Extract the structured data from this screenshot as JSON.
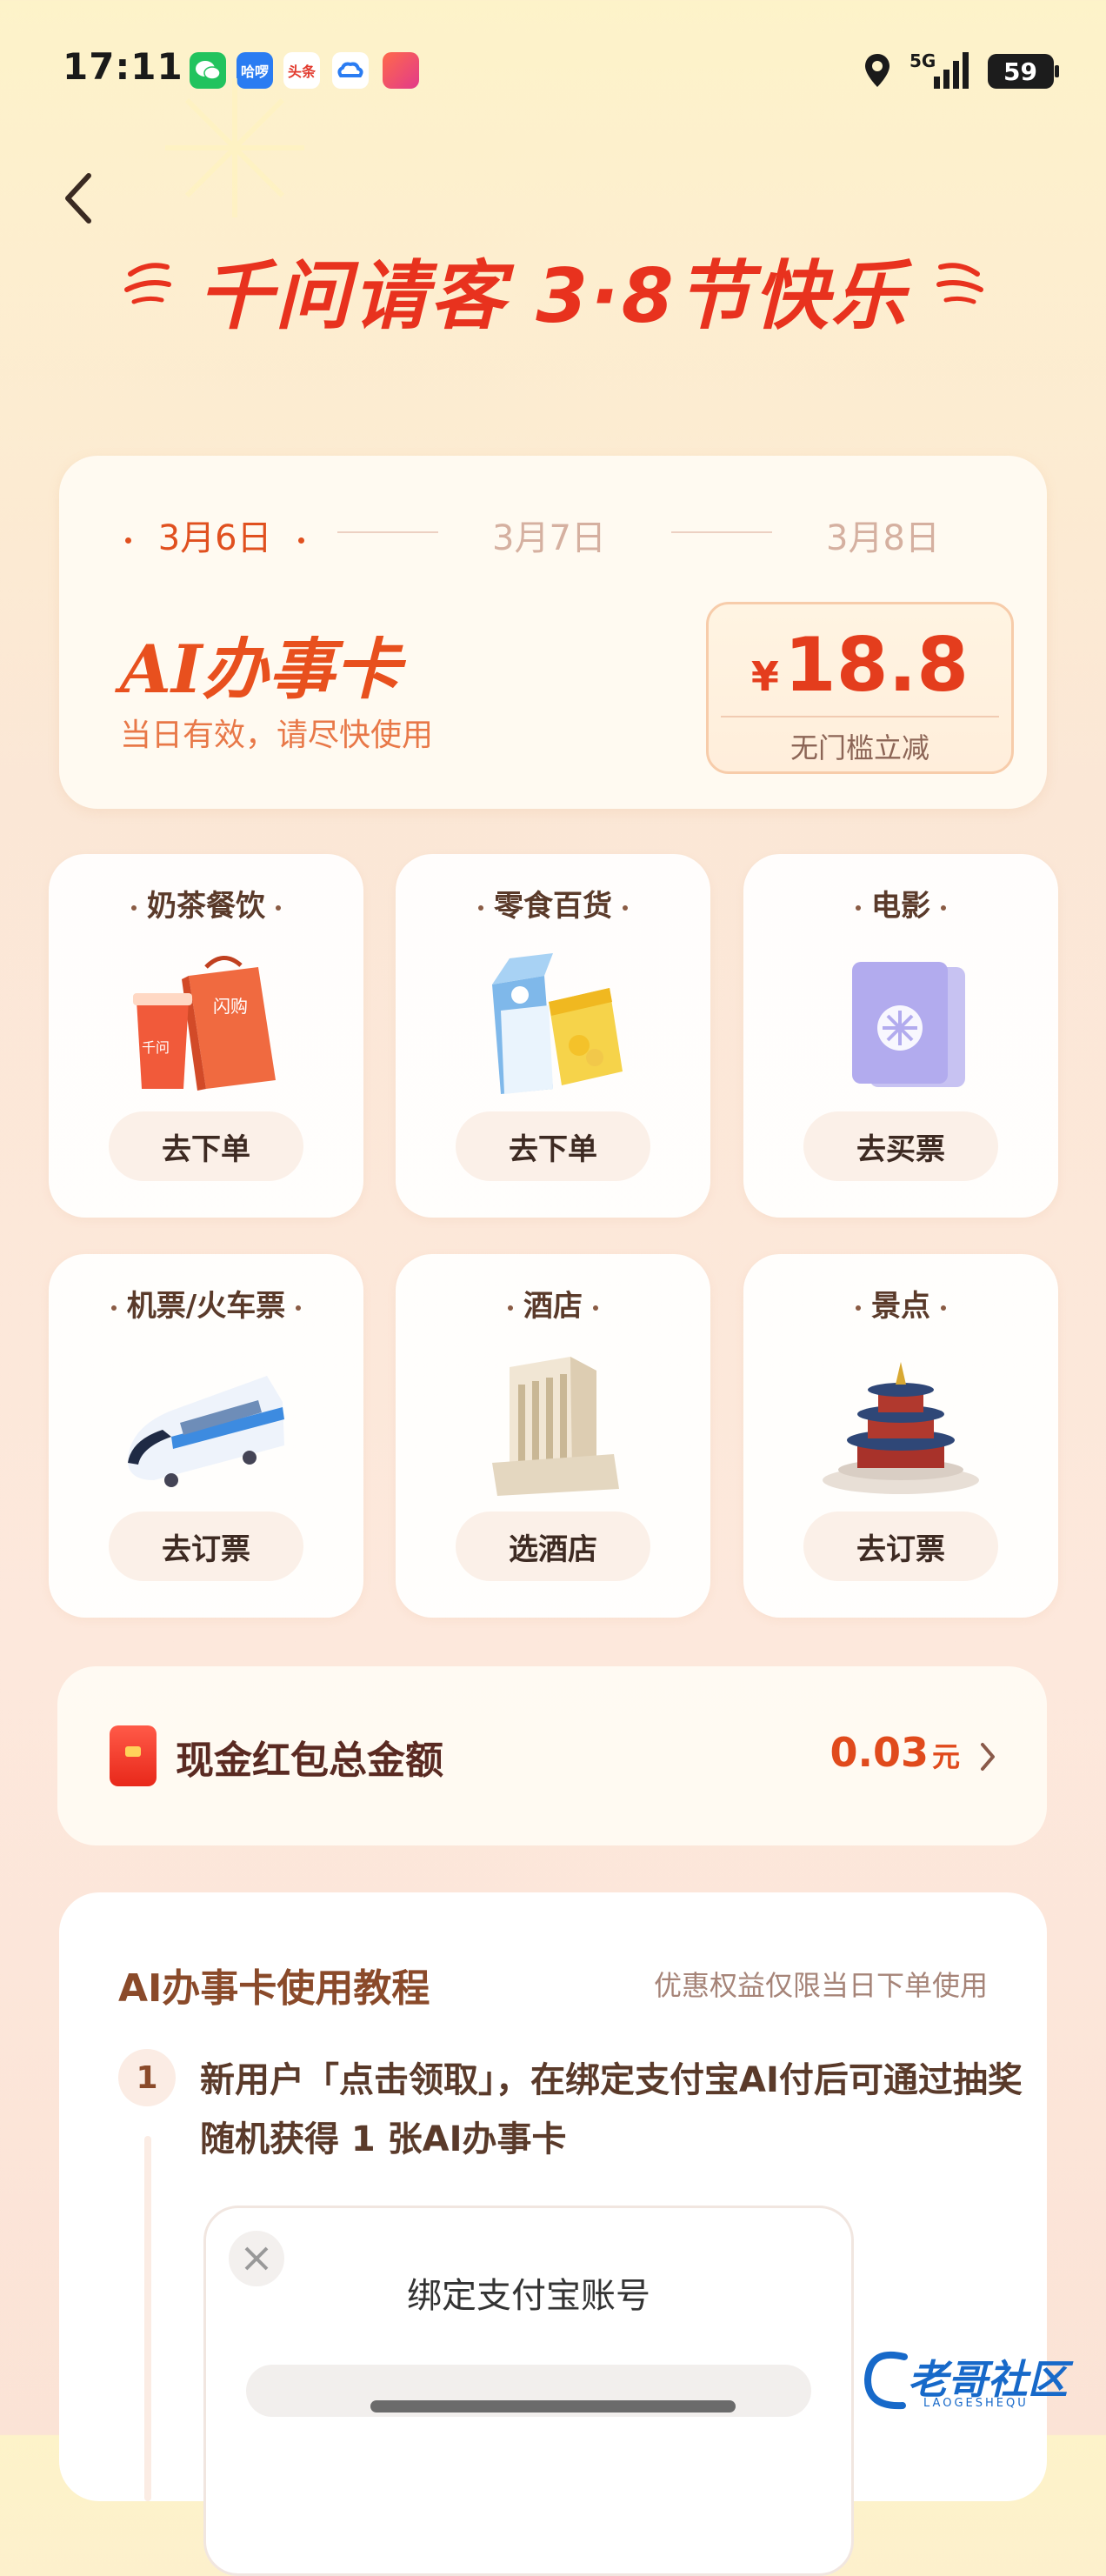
{
  "status_bar": {
    "time": "17:11",
    "apps": [
      {
        "name": "wechat-icon",
        "color": "#22c35e",
        "text": ""
      },
      {
        "name": "haluo-icon",
        "color": "#2a7cf2",
        "text": "哈啰"
      },
      {
        "name": "toutiao-icon",
        "color": "#e23a2e",
        "text": "头条"
      },
      {
        "name": "cloud-icon",
        "color": "#ffffff",
        "text": ""
      },
      {
        "name": "game-app-icon",
        "color": "#e84a3a",
        "text": ""
      }
    ],
    "network": "5G",
    "battery": "59"
  },
  "header": {
    "title": "千问请客 3·8节快乐"
  },
  "date_card": {
    "dates": [
      "3月6日",
      "3月7日",
      "3月8日"
    ],
    "active_index": 0,
    "card_title": "AI办事卡",
    "card_subtitle": "当日有效，请尽快使用",
    "coupon_currency": "¥",
    "coupon_amount": "18.8",
    "coupon_note": "无门槛立减"
  },
  "categories": [
    {
      "title": "奶茶餐饮",
      "button": "去下单",
      "icon": "milk-tea-bag-icon"
    },
    {
      "title": "零食百货",
      "button": "去下单",
      "icon": "snack-milk-icon"
    },
    {
      "title": "电影",
      "button": "去买票",
      "icon": "movie-ticket-icon"
    },
    {
      "title": "机票/火车票",
      "button": "去订票",
      "icon": "train-icon"
    },
    {
      "title": "酒店",
      "button": "选酒店",
      "icon": "hotel-icon"
    },
    {
      "title": "景点",
      "button": "去订票",
      "icon": "temple-icon"
    }
  ],
  "category_illustration_labels": {
    "shangou": "闪购",
    "qianwen": "千问"
  },
  "red_packet": {
    "label": "现金红包总金额",
    "amount": "0.03",
    "unit": "元"
  },
  "tutorial": {
    "title": "AI办事卡使用教程",
    "note": "优惠权益仅限当日下单使用",
    "steps": [
      {
        "num": "1",
        "text": "新用户「点击领取」，在绑定支付宝AI付后可通过抽奖随机获得 1 张AI办事卡"
      }
    ],
    "mock_dialog_title": "绑定支付宝账号"
  },
  "watermark": {
    "text": "老哥社区",
    "sub": "LAOGESHEQU"
  },
  "colors": {
    "accent_red": "#e8321e",
    "orange": "#e8501e",
    "brown_text": "#5a3a2a"
  }
}
